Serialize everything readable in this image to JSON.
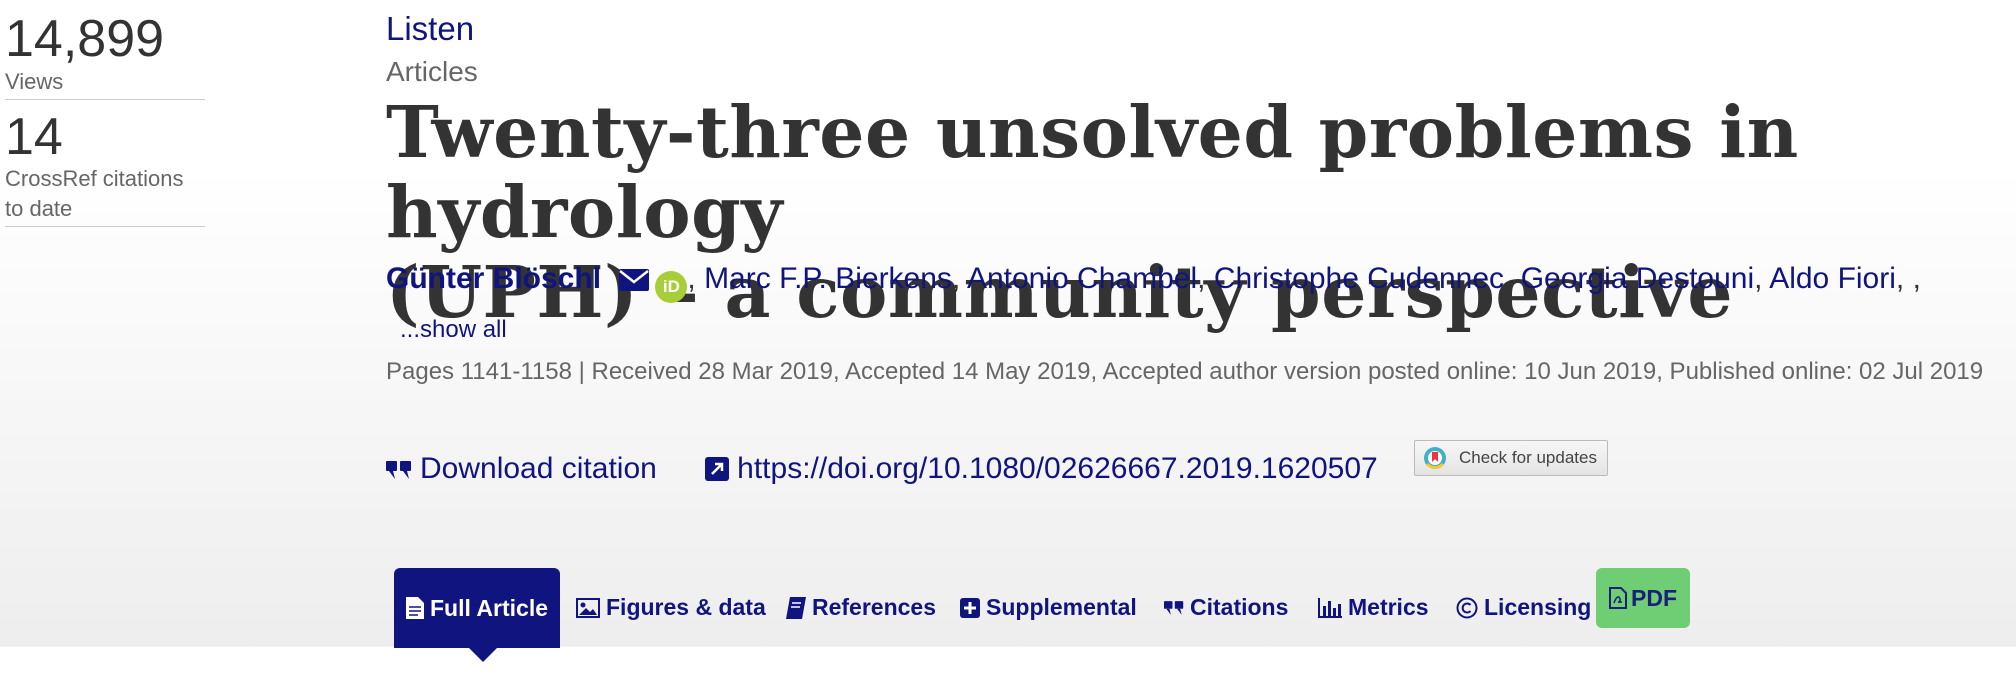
{
  "metrics": {
    "views_count": "14,899",
    "views_label": "Views",
    "citations_count": "14",
    "citations_label_line1": "CrossRef citations",
    "citations_label_line2": "to date"
  },
  "header": {
    "listen_label": "Listen",
    "article_type": "Articles",
    "title_line1": "Twenty-three unsolved problems in hydrology",
    "title_line2": "(UPH) – a community perspective"
  },
  "authors": {
    "first": "Günter Blöschl",
    "others": [
      "Marc F.P. Bierkens",
      "Antonio Chambel",
      "Christophe Cudennec",
      "Georgia Destouni",
      "Aldo Fiori"
    ],
    "separator": ",",
    "show_all_label": "...show all"
  },
  "publication": {
    "info": "Pages 1141-1158 | Received 28 Mar 2019, Accepted 14 May 2019, Accepted author version posted online: 10 Jun 2019, Published online: 02 Jul 2019"
  },
  "actions": {
    "download_citation": "Download citation",
    "doi_link": "https://doi.org/10.1080/02626667.2019.1620507",
    "check_updates": "Check for updates"
  },
  "tabs": {
    "full_article": "Full Article",
    "figures": "Figures & data",
    "references": "References",
    "supplemental": "Supplemental",
    "citations": "Citations",
    "metrics": "Metrics",
    "licensing": "Licensing",
    "pdf": "PDF"
  },
  "colors": {
    "brand_navy": "#10147e",
    "pdf_green": "#6fce74",
    "orcid_green": "#a6ce39"
  }
}
